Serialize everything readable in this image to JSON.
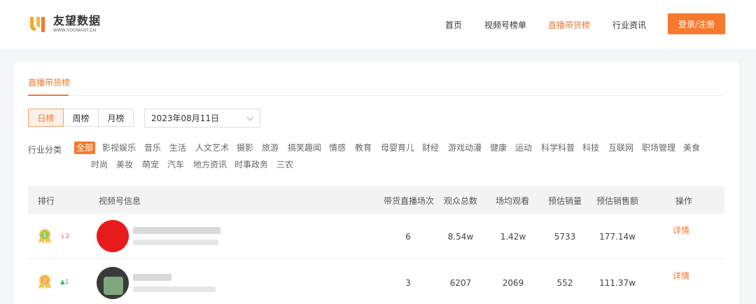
{
  "brand": {
    "name_cn": "友望数据",
    "name_en": "WWW.YOUWANT.CN",
    "logo_glyph": "uy"
  },
  "nav": {
    "items": [
      {
        "label": "首页",
        "active": false
      },
      {
        "label": "视频号榜单",
        "active": false
      },
      {
        "label": "直播带货榜",
        "active": true
      },
      {
        "label": "行业资讯",
        "active": false
      }
    ],
    "login_label": "登录/注册"
  },
  "tabs": {
    "active_label": "直播带货榜"
  },
  "period": {
    "options": [
      {
        "label": "日榜",
        "active": true
      },
      {
        "label": "周榜",
        "active": false
      },
      {
        "label": "月榜",
        "active": false
      }
    ],
    "date_value": "2023年08月11日"
  },
  "categories": {
    "label": "行业分类",
    "items": [
      "全部",
      "影视娱乐",
      "音乐",
      "生活",
      "人文艺术",
      "摄影",
      "旅游",
      "搞笑趣闻",
      "情感",
      "教育",
      "母婴育儿",
      "财经",
      "游戏动漫",
      "健康",
      "运动",
      "科学科普",
      "科技",
      "互联网",
      "职场管理",
      "美食",
      "时尚",
      "美妆",
      "萌宠",
      "汽车",
      "地方资讯",
      "时事政务",
      "三农"
    ],
    "active_index": 0
  },
  "table": {
    "headers": {
      "rank": "排行",
      "account": "视频号信息",
      "sessions": "带货直播场次",
      "audience": "观众总数",
      "avg_views": "场均观看",
      "sales_volume": "预估销量",
      "sales_amount": "预估销售额",
      "action": "操作"
    },
    "rows": [
      {
        "rank": "1",
        "trend": "↓2",
        "trend_dir": "down",
        "sessions": "6",
        "audience": "8.54w",
        "avg_views": "1.42w",
        "sales_volume": "5733",
        "sales_amount": "177.14w",
        "action": "详情"
      },
      {
        "rank": "2",
        "trend": "▲1",
        "trend_dir": "up",
        "sessions": "3",
        "audience": "6207",
        "avg_views": "2069",
        "sales_volume": "552",
        "sales_amount": "111.37w",
        "action": "详情"
      }
    ]
  },
  "colors": {
    "accent": "#f5792f",
    "badge_gold": "#f2c24a",
    "badge_green": "#8fce55",
    "down": "#f06262",
    "up": "#3bb85a"
  }
}
